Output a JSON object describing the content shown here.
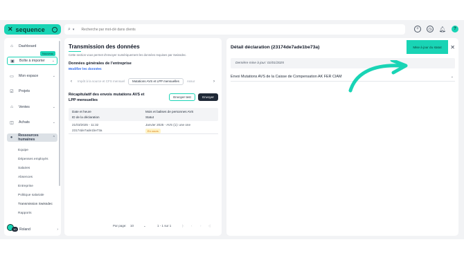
{
  "brand": {
    "name": "sequence"
  },
  "search": {
    "placeholder": "Recherche par mot-clé dans clients"
  },
  "top_icons": [
    "plus-circle-icon",
    "clock-icon",
    "bell-icon",
    "user-avatar"
  ],
  "avatar_top_initial": "?",
  "sidebar": {
    "items": [
      {
        "label": "Dashboard",
        "icon": "home-icon"
      },
      {
        "label": "Boîte à importer",
        "icon": "inbox-icon",
        "badge": "Nouveau"
      },
      {
        "label": "Mon espace",
        "icon": "wallet-icon"
      },
      {
        "label": "Projets",
        "icon": "check-square-icon"
      },
      {
        "label": "Ventes",
        "icon": "shop-icon"
      },
      {
        "label": "Achats",
        "icon": "bag-icon"
      },
      {
        "label": "Ressources humaines",
        "icon": "people-icon"
      }
    ],
    "hr_subitems": [
      "Equipe",
      "Dépenses employés",
      "Salaires",
      "Absences",
      "Entreprise",
      "Politique salariale",
      "Transmission Swissdec",
      "Rapports"
    ],
    "user": {
      "count": "10",
      "name": "Roland"
    }
  },
  "main": {
    "title": "Transmission des données",
    "description": "Cette section vous permet d'envoyer numériquement les données requises par Swissdec.",
    "company_heading": "Données générales de l'entreprise",
    "edit_link": "Modifier les données",
    "tabs": [
      "Impôt à la source et CFS mensuel",
      "Mutations AVS et LPP mensuelles",
      "Assur"
    ],
    "section_title": "Récapitulatif des envois mutations AVS et LPP mensuelles",
    "btn_test": "Envoyer test",
    "btn_send": "Envoyer",
    "table": {
      "headers": {
        "col1a": "Date et heure",
        "col1b": "ID de la déclaration",
        "col2a": "Mois et balises de personnes AVS",
        "col2b": "Statut"
      },
      "rows": [
        {
          "datetime": "21/03/2025 - 11:32",
          "id": "23174de7ade1be73a",
          "month": "Janvier 2025 - AVS (1): une one",
          "status": "En cours"
        }
      ]
    },
    "pager": {
      "per_page_label": "Par page:",
      "per_page": "10",
      "range": "1 - 1 sur 1"
    }
  },
  "detail": {
    "title": "Détail déclaration (23174de7ade1be73a)",
    "update_button": "Mise à jour du statut",
    "last_update": "Dernière mise à jour: 01/01/2025",
    "accordion_label": "Envoi Mutations AVS de la Caisse de Compensation AK FER CIAM"
  },
  "colors": {
    "accent": "#19d4b5",
    "dark": "#1f2937",
    "link": "#2563eb",
    "pending": "#d97706"
  }
}
